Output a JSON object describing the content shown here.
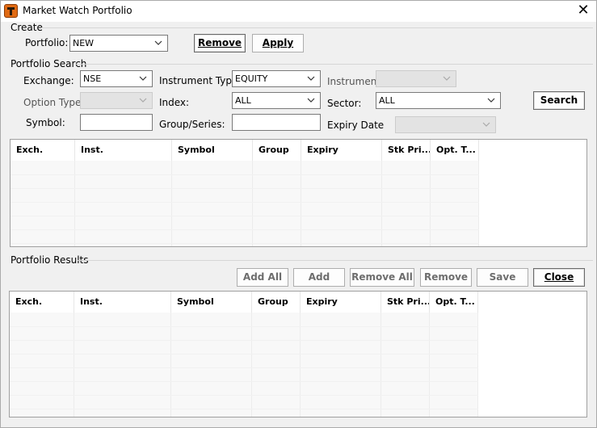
{
  "window": {
    "title": "Market Watch Portfolio"
  },
  "create": {
    "section_label": "Create",
    "portfolio_label": "Portfolio:",
    "portfolio_value": "NEW",
    "remove_label": "Remove",
    "apply_label": "Apply"
  },
  "search": {
    "section_label": "Portfolio Search",
    "exchange_label": "Exchange:",
    "exchange_value": "NSE",
    "instrument_type_label": "Instrument Type:",
    "instrument_type_value": "EQUITY",
    "instrument_label": "Instrument:",
    "instrument_value": "",
    "option_type_label": "Option Type:",
    "option_type_value": "",
    "index_label": "Index:",
    "index_value": "ALL",
    "sector_label": "Sector:",
    "sector_value": "ALL",
    "search_label": "Search",
    "symbol_label": "Symbol:",
    "symbol_value": "",
    "group_series_label": "Group/Series:",
    "group_series_value": "",
    "expiry_date_label": "Expiry Date",
    "expiry_date_value": ""
  },
  "search_grid": {
    "columns": [
      "Exch.",
      "Inst.",
      "Symbol",
      "Group",
      "Expiry",
      "Stk Pri...",
      "Opt. T..."
    ]
  },
  "results": {
    "section_label": "Portfolio Results",
    "add_all_label": "Add All",
    "add_label": "Add",
    "remove_all_label": "Remove All",
    "remove_label": "Remove",
    "save_label": "Save",
    "close_label": "Close"
  },
  "results_grid": {
    "columns": [
      "Exch.",
      "Inst.",
      "Symbol",
      "Group",
      "Expiry",
      "Stk Pri...",
      "Opt. T..."
    ]
  },
  "icons": {
    "app": "app-logo-icon",
    "close": "close-icon",
    "dropdown": "chevron-down-icon"
  }
}
